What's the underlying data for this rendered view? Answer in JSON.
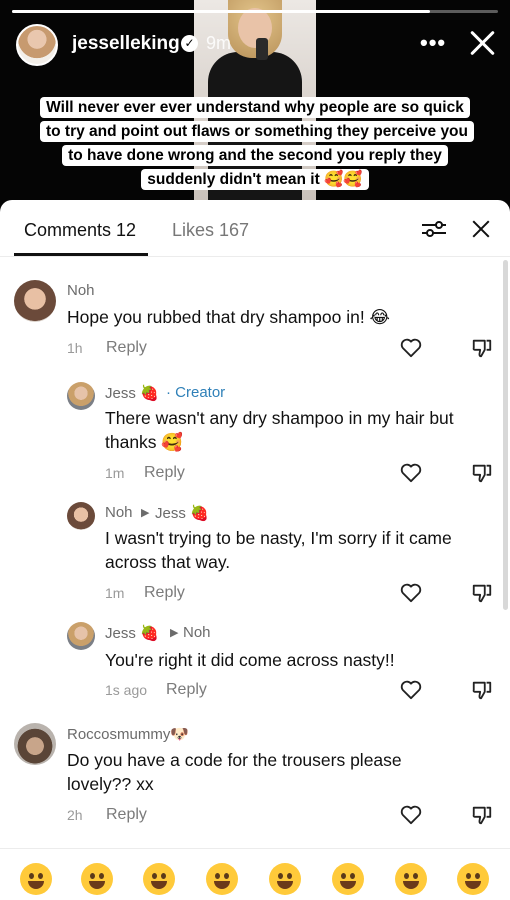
{
  "story": {
    "username": "jesselleking",
    "time": "9m",
    "caption": "Will never ever ever understand why people are so quick to try and point out flaws or something they perceive you to have done wrong and the second you reply they suddenly didn't mean it 🥰🥰",
    "progress": 0.86
  },
  "tabs": {
    "comments_label": "Comments 12",
    "likes_label": "Likes 167"
  },
  "comments": [
    {
      "name": "Noh",
      "text": "Hope you rubbed that dry shampoo in! 😂",
      "time": "1h",
      "reply": "Reply"
    },
    {
      "name": "Jess 🍓",
      "creator": "· Creator",
      "text": "There wasn't any dry shampoo in my hair but thanks 🥰",
      "time": "1m",
      "reply": "Reply"
    },
    {
      "name": "Noh",
      "reply_to": "Jess 🍓",
      "text": "I wasn't trying to be nasty, I'm sorry if it came across that way.",
      "time": "1m",
      "reply": "Reply"
    },
    {
      "name": "Jess 🍓",
      "reply_to": "Noh",
      "text": "You're right it did come across nasty!!",
      "time": "1s ago",
      "reply": "Reply"
    },
    {
      "name": "Roccosmummy🐶",
      "text": "Do you have a code for the trousers please lovely?? xx",
      "time": "2h",
      "reply": "Reply"
    }
  ],
  "emoji_bar": [
    "😁",
    "🥰",
    "😂",
    "😳",
    "😏",
    "😅",
    "🥺",
    "😌"
  ],
  "colors": {
    "creator": "#2f80b8",
    "emoji_face": "#ffca3a"
  }
}
